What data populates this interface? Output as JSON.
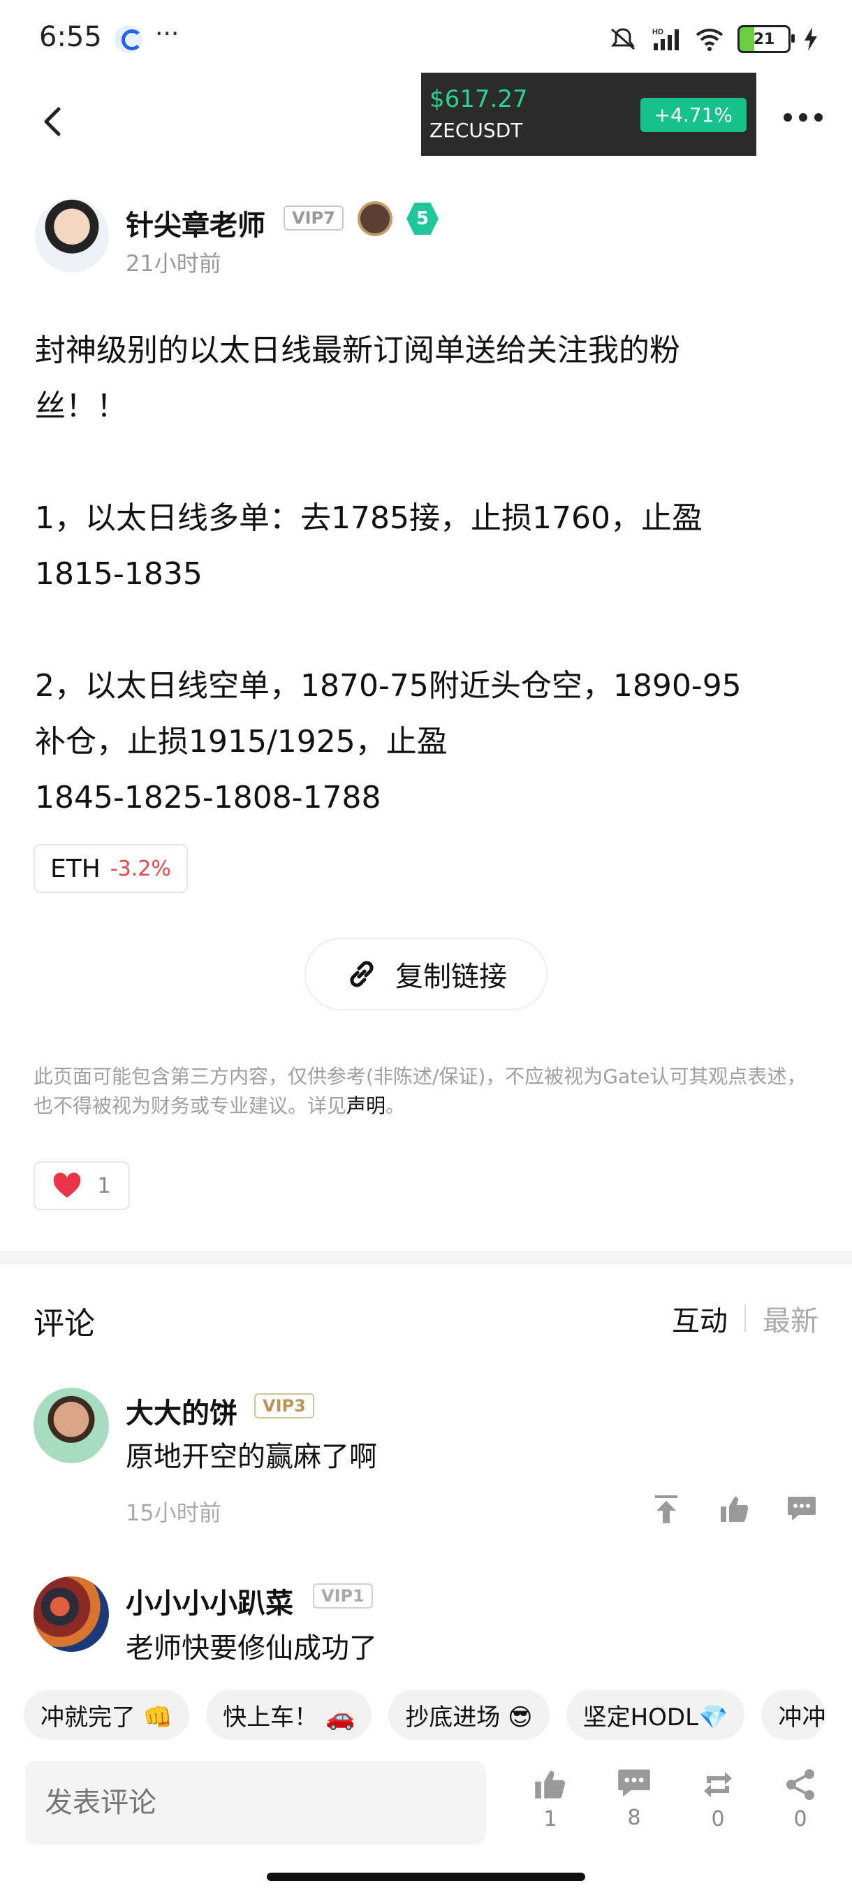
{
  "status_bar": {
    "time": "6:55",
    "more": "···",
    "battery": "21",
    "network_label": "HD"
  },
  "header": {
    "back_icon": "chevron-left-icon",
    "ticker": {
      "price": "$617.27",
      "symbol": "ZECUSDT",
      "change": "+4.71%",
      "change_color": "#17c28a"
    },
    "more_icon": "more-horizontal-icon"
  },
  "author": {
    "name": "针尖章老师",
    "vip": "VIP7",
    "level": "5",
    "time": "21小时前"
  },
  "post": {
    "body": "封神级别的以太日线最新订阅单送给关注我的粉\n丝！！\n\n1，以太日线多单：去1785接，止损1760，止盈\n1815-1835\n\n2，以太日线空单，1870-75附近头仓空，1890-95\n补仓，止损1915/1925，止盈\n1845-1825-1808-1788"
  },
  "tag": {
    "symbol": "ETH",
    "change": "-3.2%",
    "change_color": "#e5484d"
  },
  "copy_link": {
    "label": "复制链接",
    "icon": "link-icon"
  },
  "disclaimer": {
    "text": "此页面可能包含第三方内容，仅供参考(非陈述/保证)，不应被视为Gate认可其观点表述，也不得被视为财务或专业建议。详见",
    "link": "声明",
    "end": "。"
  },
  "likes": {
    "count": "1",
    "icon": "heart-icon",
    "color": "#e8334a"
  },
  "comments": {
    "title": "评论",
    "sort_active": "互动",
    "sort_inactive": "最新",
    "items": [
      {
        "name": "大大的饼",
        "vip": "VIP3",
        "text": "原地开空的赢麻了啊",
        "time": "15小时前"
      },
      {
        "name": "小小小小趴菜",
        "vip": "VIP1",
        "text": "老师快要修仙成功了"
      }
    ]
  },
  "quick_replies": [
    "冲就完了 👊",
    "快上车！ 🚗",
    "抄底进场 😎",
    "坚定HODL💎",
    "冲冲"
  ],
  "bottom_bar": {
    "input_placeholder": "发表评论",
    "like_count": "1",
    "comment_count": "8",
    "repost_count": "0",
    "share_count": "0"
  }
}
